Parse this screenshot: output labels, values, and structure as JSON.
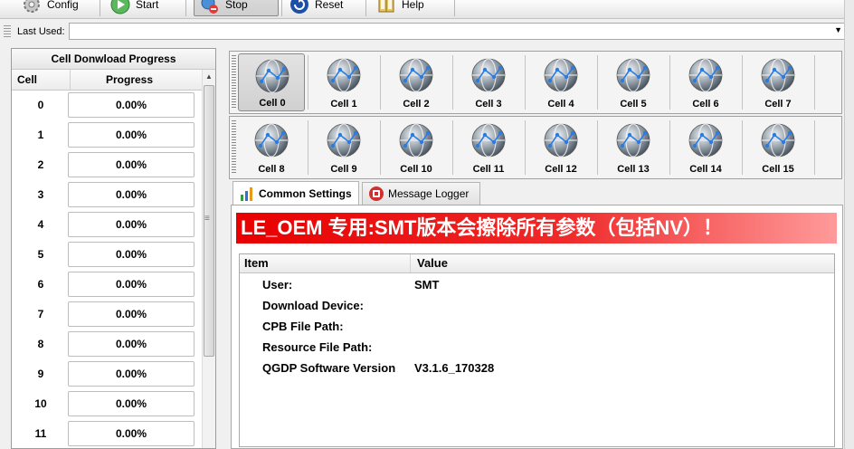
{
  "toolbar": {
    "buttons": [
      {
        "label": "Config",
        "icon": "gear-icon"
      },
      {
        "label": "Start",
        "icon": "play-icon"
      },
      {
        "label": "Stop",
        "icon": "stop-icon",
        "pressed": true
      },
      {
        "label": "Reset",
        "icon": "reset-icon"
      },
      {
        "label": "Help",
        "icon": "book-icon"
      }
    ]
  },
  "last_used": {
    "label": "Last Used:",
    "value": ""
  },
  "progress_panel": {
    "title": "Cell Donwload Progress",
    "col_cell": "Cell",
    "col_progress": "Progress",
    "rows": [
      {
        "cell": "0",
        "progress": "0.00%"
      },
      {
        "cell": "1",
        "progress": "0.00%"
      },
      {
        "cell": "2",
        "progress": "0.00%"
      },
      {
        "cell": "3",
        "progress": "0.00%"
      },
      {
        "cell": "4",
        "progress": "0.00%"
      },
      {
        "cell": "5",
        "progress": "0.00%"
      },
      {
        "cell": "6",
        "progress": "0.00%"
      },
      {
        "cell": "7",
        "progress": "0.00%"
      },
      {
        "cell": "8",
        "progress": "0.00%"
      },
      {
        "cell": "9",
        "progress": "0.00%"
      },
      {
        "cell": "10",
        "progress": "0.00%"
      },
      {
        "cell": "11",
        "progress": "0.00%"
      }
    ]
  },
  "cells": {
    "row1": [
      "Cell 0",
      "Cell 1",
      "Cell 2",
      "Cell 3",
      "Cell 4",
      "Cell 5",
      "Cell 6",
      "Cell 7"
    ],
    "row2": [
      "Cell 8",
      "Cell 9",
      "Cell 10",
      "Cell 11",
      "Cell 12",
      "Cell 13",
      "Cell 14",
      "Cell 15"
    ],
    "selected": "Cell 0",
    "icon": "globe-icon"
  },
  "tabs": [
    {
      "label": "Common Settings",
      "icon": "bar-chart-icon",
      "active": true
    },
    {
      "label": "Message Logger",
      "icon": "logger-icon",
      "active": false
    }
  ],
  "settings": {
    "banner": "LE_OEM 专用:SMT版本会擦除所有参数（包括NV）！",
    "banner_color": "#e80000",
    "col_item": "Item",
    "col_value": "Value",
    "rows": [
      {
        "item": "User:",
        "value": "SMT"
      },
      {
        "item": "Download Device:",
        "value": ""
      },
      {
        "item": "CPB File Path:",
        "value": ""
      },
      {
        "item": "Resource File Path:",
        "value": ""
      },
      {
        "item": "QGDP Software Version",
        "value": "V3.1.6_170328"
      }
    ]
  }
}
